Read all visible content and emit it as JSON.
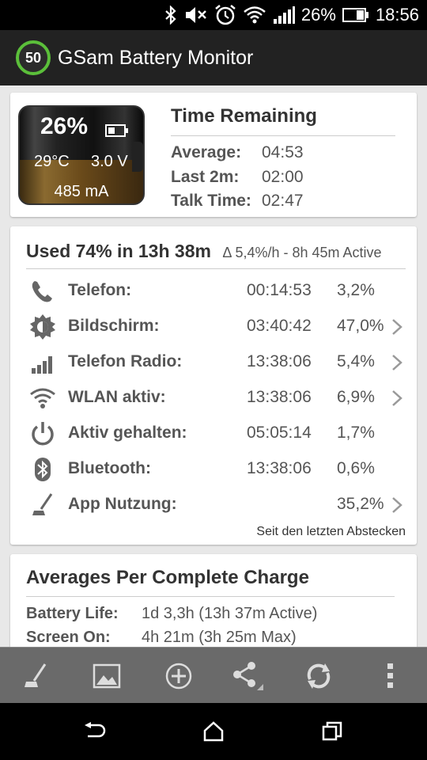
{
  "status_bar": {
    "battery_percent": "26%",
    "time": "18:56",
    "icons": [
      "bluetooth-icon",
      "mute-icon",
      "alarm-icon",
      "wifi-icon",
      "signal-icon",
      "battery-icon"
    ]
  },
  "app_bar": {
    "logo_number": "50",
    "title": "GSam Battery Monitor"
  },
  "battery_card": {
    "percent": "26%",
    "temperature": "29°C",
    "voltage": "3.0 V",
    "current": "485 mA",
    "level": 0.26,
    "time_remaining": {
      "title": "Time Remaining",
      "rows": [
        {
          "label": "Average:",
          "value": "04:53"
        },
        {
          "label": "Last 2m:",
          "value": "02:00"
        },
        {
          "label": "Talk Time:",
          "value": "02:47"
        }
      ]
    }
  },
  "usage_card": {
    "heading": "Used 74% in 13h 38m",
    "subheading": "Δ 5,4%/h - 8h 45m Active",
    "rows": [
      {
        "icon": "phone-icon",
        "label": "Telefon:",
        "time": "00:14:53",
        "percent": "3,2%",
        "chevron": false
      },
      {
        "icon": "brightness-icon",
        "label": "Bildschirm:",
        "time": "03:40:42",
        "percent": "47,0%",
        "chevron": true
      },
      {
        "icon": "signal-bars-icon",
        "label": "Telefon Radio:",
        "time": "13:38:06",
        "percent": "5,4%",
        "chevron": true
      },
      {
        "icon": "wifi-icon",
        "label": "WLAN aktiv:",
        "time": "13:38:06",
        "percent": "6,9%",
        "chevron": true
      },
      {
        "icon": "power-icon",
        "label": "Aktiv gehalten:",
        "time": "05:05:14",
        "percent": "1,7%",
        "chevron": false
      },
      {
        "icon": "bluetooth-icon",
        "label": "Bluetooth:",
        "time": "13:38:06",
        "percent": "0,6%",
        "chevron": false
      },
      {
        "icon": "broom-icon",
        "label": "App Nutzung:",
        "time": "",
        "percent": "35,2%",
        "chevron": true
      }
    ],
    "footer": "Seit den letzten Abstecken"
  },
  "averages_card": {
    "title": "Averages Per Complete Charge",
    "rows": [
      {
        "label": "Battery Life:",
        "value": "1d 3,3h (13h 37m Active)"
      },
      {
        "label": "Screen On:",
        "value": "4h 21m (3h 25m Max)"
      }
    ]
  },
  "toolbar": {
    "buttons": [
      "broom-icon",
      "image-icon",
      "add-circle-icon",
      "share-icon",
      "refresh-icon",
      "overflow-menu-icon"
    ]
  },
  "nav_bar": {
    "buttons": [
      "back-icon",
      "home-icon",
      "recents-icon"
    ]
  },
  "colors": {
    "accent_green": "#5bbf3a",
    "app_bar": "#222222",
    "toolbar": "#6a6a6a"
  }
}
